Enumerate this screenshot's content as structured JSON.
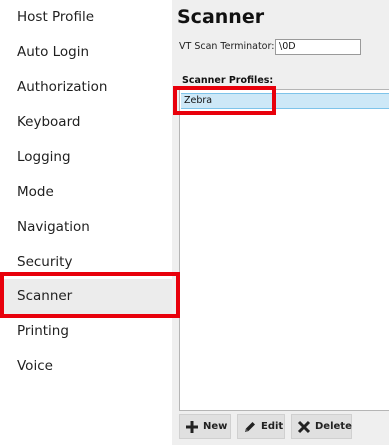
{
  "sidebar": {
    "items": [
      {
        "label": "Host Profile"
      },
      {
        "label": "Auto Login"
      },
      {
        "label": "Authorization"
      },
      {
        "label": "Keyboard"
      },
      {
        "label": "Logging"
      },
      {
        "label": "Mode"
      },
      {
        "label": "Navigation"
      },
      {
        "label": "Security"
      },
      {
        "label": "Scanner",
        "selected": true
      },
      {
        "label": "Printing"
      },
      {
        "label": "Voice"
      }
    ]
  },
  "main": {
    "title": "Scanner",
    "vt_scan_terminator": {
      "label": "VT Scan Terminator:",
      "value": "\\0D"
    },
    "scanner_profiles": {
      "label": "Scanner Profiles:",
      "items": [
        "Zebra"
      ]
    }
  },
  "buttons": {
    "new": "New",
    "edit": "Edit",
    "delete": "Delete"
  },
  "colors": {
    "highlight": "#e8000b",
    "selection": "#cde8f7",
    "panel": "#efefef"
  }
}
